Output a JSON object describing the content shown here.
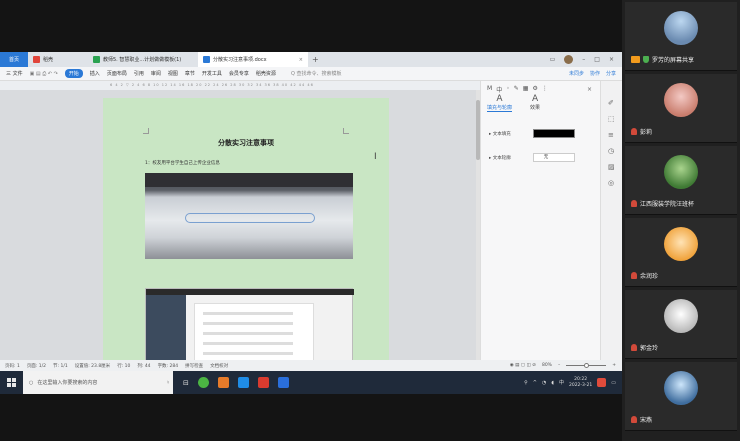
{
  "window": {
    "tabs": [
      {
        "label": "首页"
      },
      {
        "label": "稻壳"
      },
      {
        "label": "教师5. 智慧职业...计划做做模板(1)"
      },
      {
        "label": "分散实习注意事项.docx"
      }
    ],
    "add_tab": "+"
  },
  "menubar": {
    "items": [
      "三 文件",
      "开始",
      "插入",
      "页面布局",
      "引用",
      "审阅",
      "视图",
      "章节",
      "开发工具",
      "会员专享",
      "稻壳资源"
    ],
    "search": "Q 查找命令、搜索模板",
    "right_items": [
      "未同步",
      "协作",
      "分享"
    ]
  },
  "document": {
    "title": "分散实习注意事项",
    "line1": "1：校友用平台学生自己上传企业信息"
  },
  "panel": {
    "tab_text_fill": "填充与轮廓",
    "tab_effect": "效果",
    "prop_fill_label": "▸ 文本填充",
    "prop_outline_label": "▸ 文本轮廓",
    "outline_value": "无",
    "fill_color": "#000000"
  },
  "statusbar": {
    "page": "页码: 1",
    "pages": "页面: 1/2",
    "section": "节: 1/1",
    "position": "设置值: 23.8厘米",
    "row": "行: 10",
    "col": "列: 44",
    "words": "字数: 284",
    "spell": "拼写检查",
    "doc_check": "文档校对",
    "zoom": "80%"
  },
  "taskbar": {
    "search_placeholder": "在这里输入你要搜索的内容",
    "time": "20:22",
    "date": "2022-3-21"
  },
  "participants": [
    {
      "name": "罗芳的屏幕共享",
      "sharing": true
    },
    {
      "name": "彭莉",
      "sharing": false
    },
    {
      "name": "江西服装学院汪班杯",
      "sharing": false
    },
    {
      "name": "余润珍",
      "sharing": false
    },
    {
      "name": "郭金玲",
      "sharing": false
    },
    {
      "name": "宋燕",
      "sharing": false
    }
  ]
}
